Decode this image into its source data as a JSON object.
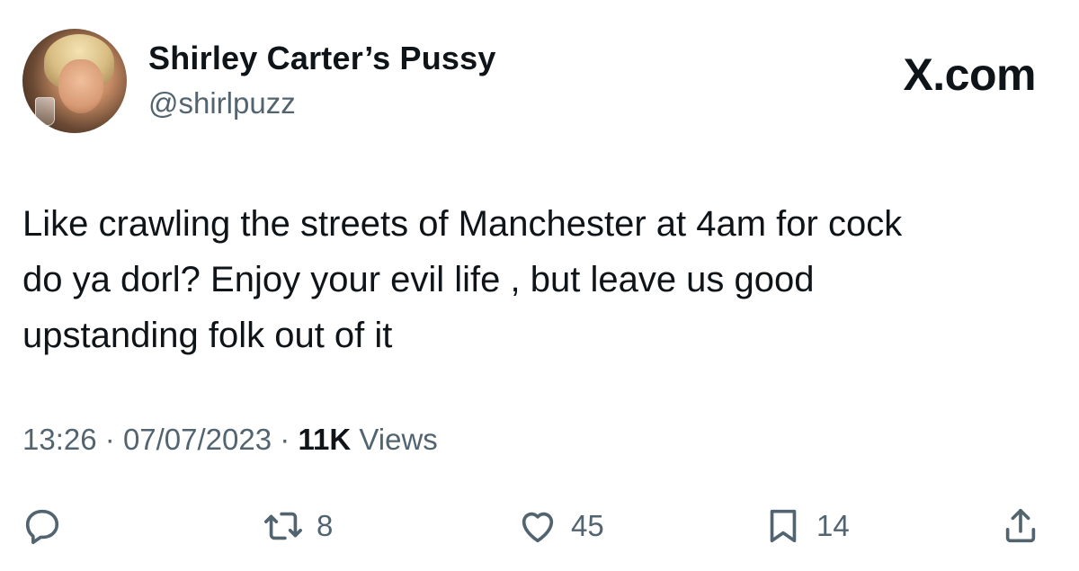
{
  "author": {
    "display_name": "Shirley Carter’s Pussy",
    "handle": "@shirlpuzz"
  },
  "brand": "X.com",
  "tweet": {
    "text": "Like crawling the streets of Manchester at 4am for cock\ndo ya dorl?  Enjoy your  evil life , but leave us good\nupstanding folk out of it"
  },
  "meta": {
    "time": "13:26",
    "separator": "·",
    "date": "07/07/2023",
    "views_count": "11K",
    "views_label": "Views"
  },
  "actions": {
    "reposts": "8",
    "likes": "45",
    "bookmarks": "14"
  },
  "colors": {
    "text": "#0f1419",
    "secondary": "#536471",
    "background": "#ffffff"
  },
  "icons": [
    "reply-icon",
    "repost-icon",
    "like-icon",
    "bookmark-icon",
    "share-icon"
  ]
}
